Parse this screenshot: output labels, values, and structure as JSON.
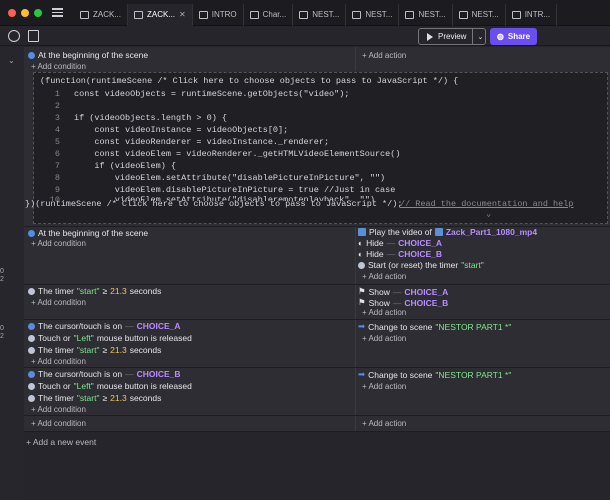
{
  "tabs": [
    {
      "label": "ZACK..."
    },
    {
      "label": "ZACK..."
    },
    {
      "label": "INTRO"
    },
    {
      "label": "Char..."
    },
    {
      "label": "NEST..."
    },
    {
      "label": "NEST..."
    },
    {
      "label": "NEST..."
    },
    {
      "label": "NEST..."
    },
    {
      "label": "INTR..."
    }
  ],
  "toolbar": {
    "preview_label": "Preview",
    "share_label": "Share"
  },
  "events": {
    "e1": {
      "condition": "At the beginning of the scene",
      "add_condition": "+ Add condition",
      "add_action": "+ Add action"
    },
    "code": {
      "header": "(function(runtimeScene /* Click here to choose objects to pass to JavaScript */) {",
      "lines": [
        {
          "n": "1",
          "t": "const videoObjects = runtimeScene.getObjects(\"video\");"
        },
        {
          "n": "2",
          "t": ""
        },
        {
          "n": "3",
          "t": "if (videoObjects.length > 0) {"
        },
        {
          "n": "4",
          "t": "    const videoInstance = videoObjects[0];"
        },
        {
          "n": "5",
          "t": "    const videoRenderer = videoInstance._renderer;"
        },
        {
          "n": "6",
          "t": "    const videoElem = videoRenderer._getHTMLVideoElementSource()"
        },
        {
          "n": "7",
          "t": "    if (videoElem) {"
        },
        {
          "n": "8",
          "t": "        videoElem.setAttribute(\"disablePictureInPicture\", \"\")"
        },
        {
          "n": "9",
          "t": "        videoElem.disablePictureInPicture = true //Just in case"
        },
        {
          "n": "10",
          "t": "        videoElem.setAttribute(\"disableremoteplayback\", \"\")"
        }
      ],
      "footer": "})(runtimeScene /* Click here to choose objects to pass to JavaScript */);",
      "doc_link": "// Read the documentation and help"
    },
    "e2": {
      "condition": "At the beginning of the scene",
      "add_condition": "+ Add condition",
      "actions": [
        {
          "prefix": "Play the video of",
          "obj": "Zack_Part1_1080_mp4"
        },
        {
          "prefix": "Hide",
          "obj": "CHOICE_A"
        },
        {
          "prefix": "Hide",
          "obj": "CHOICE_B"
        },
        {
          "prefix": "Start (or reset) the timer",
          "str": "\"start\""
        }
      ],
      "add_action": "+ Add action"
    },
    "e3": {
      "cond_prefix": "The timer",
      "cond_str": "\"start\"",
      "cond_op": "≥",
      "cond_num": "21.3",
      "cond_suffix": "seconds",
      "add_condition": "+ Add condition",
      "actions": [
        {
          "prefix": "Show",
          "obj": "CHOICE_A"
        },
        {
          "prefix": "Show",
          "obj": "CHOICE_B"
        }
      ],
      "add_action": "+ Add action"
    },
    "e4": {
      "c1_prefix": "The cursor/touch is on",
      "c1_obj": "CHOICE_A",
      "c2_prefix": "Touch or",
      "c2_str": "\"Left\"",
      "c2_suffix": "mouse button is released",
      "c3_prefix": "The timer",
      "c3_str": "\"start\"",
      "c3_op": "≥",
      "c3_num": "21.3",
      "c3_suffix": "seconds",
      "add_condition": "+ Add condition",
      "action_prefix": "Change to scene",
      "action_str": "\"NESTOR PART1 *\"",
      "add_action": "+ Add action"
    },
    "e5": {
      "c1_prefix": "The cursor/touch is on",
      "c1_obj": "CHOICE_B",
      "c2_prefix": "Touch or",
      "c2_str": "\"Left\"",
      "c2_suffix": "mouse button is released",
      "c3_prefix": "The timer",
      "c3_str": "\"start\"",
      "c3_op": "≥",
      "c3_num": "21.3",
      "c3_suffix": "seconds",
      "add_condition": "+ Add condition",
      "action_prefix": "Change to scene",
      "action_str": "\"NESTOR PART1 *\"",
      "add_action": "+ Add action"
    },
    "e6": {
      "add_condition": "+ Add condition",
      "add_action": "+ Add action"
    },
    "add_event": "+ Add a new event"
  },
  "gutter_marks": [
    "0",
    "2",
    "0",
    "2"
  ],
  "colors": {
    "accent": "#6b4ef0",
    "string": "#7ee787",
    "number": "#f0c75e",
    "object": "#b98cff"
  }
}
